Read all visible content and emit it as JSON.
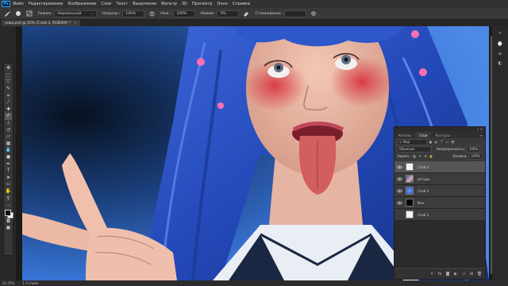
{
  "menubar": {
    "logo": "Ps",
    "items": [
      "Файл",
      "Редактирование",
      "Изображение",
      "Слои",
      "Текст",
      "Выделение",
      "Фильтр",
      "3D",
      "Просмотр",
      "Окно",
      "Справка"
    ]
  },
  "options": {
    "mode_label": "Режим:",
    "mode_value": "Нормальный",
    "opacity_label": "Непрозр.:",
    "opacity_value": "100%",
    "press_label": "Наж.:",
    "press_value": "100%",
    "flow_label": "Нажим:",
    "flow_value": "5%",
    "smooth_label": "Сглаживание:",
    "smooth_value": ""
  },
  "document": {
    "tab_title": "нова.psd @ 25% (Слой 4, RGB/8#) *",
    "close_glyph": "×"
  },
  "status": {
    "zoom": "24,75%",
    "info": "1 0 слоев"
  },
  "layers_panel": {
    "top_controls": "« ×",
    "tabs": [
      "Каналы",
      "Слои",
      "Контуры"
    ],
    "active_tab": "Слои",
    "menu_glyph": "≡",
    "filter_label": "Вид",
    "blend_mode": "Обычные",
    "opacity_label": "Непрозрачность:",
    "opacity_value": "100%",
    "lock_label": "Закреп.:",
    "fill_label": "Заливка:",
    "fill_value": "100%",
    "layers": [
      {
        "name": "Слой 4",
        "visible": true,
        "selected": true,
        "thumb": "white"
      },
      {
        "name": "ретушь",
        "visible": true,
        "selected": false,
        "thumb": "photo"
      },
      {
        "name": "Слой 3",
        "visible": true,
        "selected": false,
        "thumb": "blue"
      },
      {
        "name": "Фон",
        "visible": true,
        "selected": false,
        "thumb": "black"
      },
      {
        "name": "Слой 1",
        "visible": false,
        "selected": false,
        "thumb": "white"
      }
    ],
    "bottom_icons": [
      "link-icon",
      "fx-icon",
      "mask-icon",
      "adjustment-icon",
      "folder-icon",
      "new-layer-icon",
      "trash-icon"
    ]
  },
  "colors": {
    "ui_dark": "#282828",
    "panel": "#3a3a3a",
    "hair_blue": "#2d55c8",
    "background_blue": "#3a77e0",
    "ps_blue": "#31a8ff"
  }
}
